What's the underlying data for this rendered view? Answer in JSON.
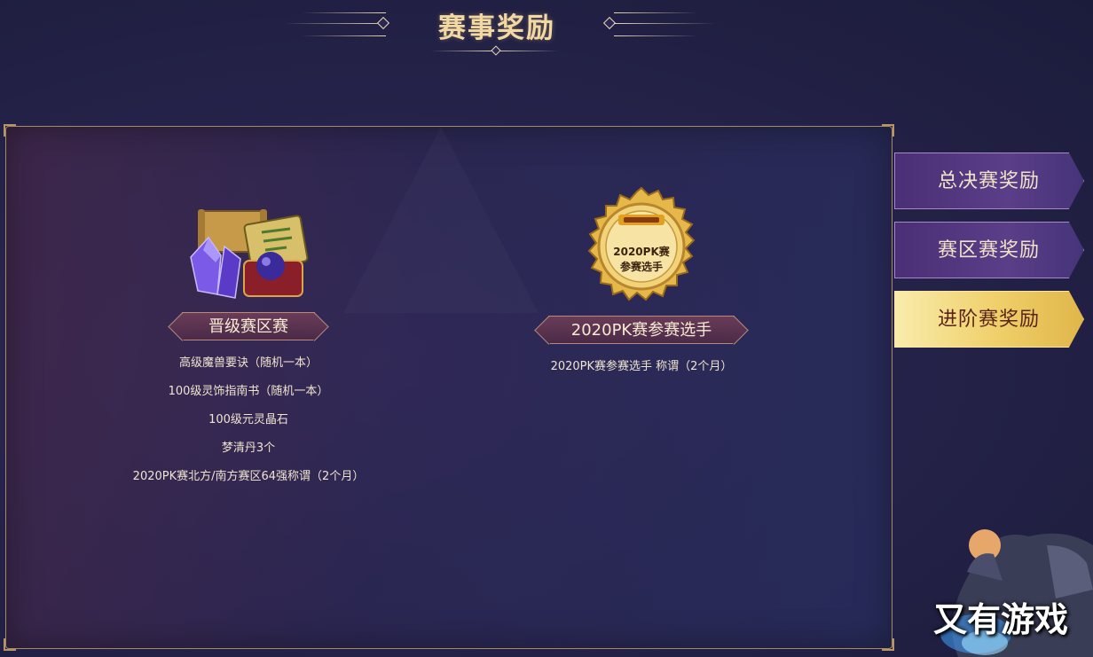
{
  "header": {
    "title": "赛事奖励"
  },
  "rewards": [
    {
      "icon": "reward-bundle-icon",
      "name": "晋级赛区赛",
      "items": [
        "高级魔兽要诀（随机一本）",
        "100级灵饰指南书（随机一本）",
        "100级元灵晶石",
        "梦清丹3个",
        "2020PK赛北方/南方赛区64强称谓（2个月）"
      ]
    },
    {
      "icon": "medal-icon",
      "medal_text": [
        "2020PK赛",
        "参赛选手"
      ],
      "name": "2020PK赛参赛选手",
      "items": [
        "2020PK赛参赛选手 称谓（2个月）"
      ]
    }
  ],
  "tabs": [
    {
      "label": "总决赛奖励",
      "active": false
    },
    {
      "label": "赛区赛奖励",
      "active": false
    },
    {
      "label": "进阶赛奖励",
      "active": true
    }
  ],
  "watermark": "又有游戏",
  "colors": {
    "gold": "#f2d9a3",
    "active_tab": "#efcf69",
    "tab_bg": "#4a2f76",
    "panel_border": "#a78a63"
  }
}
